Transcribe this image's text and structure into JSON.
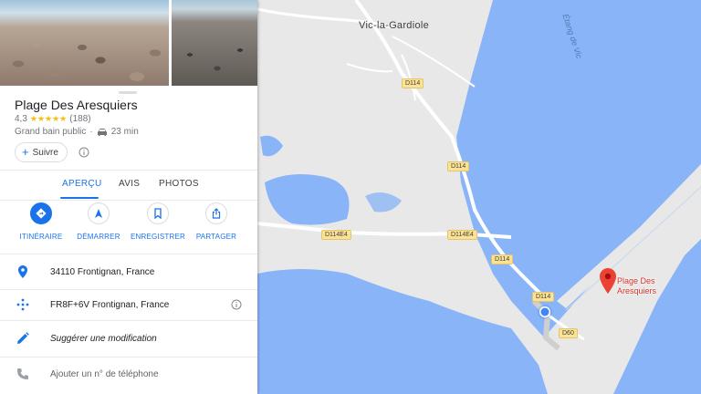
{
  "place": {
    "name": "Plage Des Aresquiers",
    "rating": "4,3",
    "stars": "★★★★★",
    "review_count": "(188)",
    "category": "Grand bain public",
    "separator": "·",
    "drive_time": "23 min",
    "follow_label": "Suivre"
  },
  "tabs": [
    {
      "label": "APERÇU",
      "active": true
    },
    {
      "label": "AVIS",
      "active": false
    },
    {
      "label": "PHOTOS",
      "active": false
    }
  ],
  "actions": [
    {
      "label": "ITINÉRAIRE",
      "icon": "directions-icon"
    },
    {
      "label": "DÉMARRER",
      "icon": "navigation-icon"
    },
    {
      "label": "ENREGISTRER",
      "icon": "bookmark-icon"
    },
    {
      "label": "PARTAGER",
      "icon": "share-icon"
    }
  ],
  "details": [
    {
      "text": "34110 Frontignan, France",
      "icon": "location-pin-icon"
    },
    {
      "text": "FR8F+6V Frontignan, France",
      "icon": "plus-code-icon"
    },
    {
      "text": "Suggérer une modification",
      "icon": "edit-pencil-icon"
    },
    {
      "text": "Ajouter un n° de téléphone",
      "icon": "phone-icon"
    }
  ],
  "map": {
    "town_label": "Vic-la-Gardiole",
    "water_label": "Étang de Vic",
    "pin_label_line1": "Plage Des",
    "pin_label_line2": "Aresquiers",
    "roads": [
      "D114",
      "D114",
      "D114E4",
      "D114E4",
      "D114",
      "D114",
      "D60"
    ]
  },
  "colors": {
    "accent": "#1a73e8",
    "water": "#8ab4f8",
    "land": "#e8e8e8",
    "pin": "#ea4335",
    "road_badge": "#fde293",
    "stars": "#fbbc04"
  }
}
